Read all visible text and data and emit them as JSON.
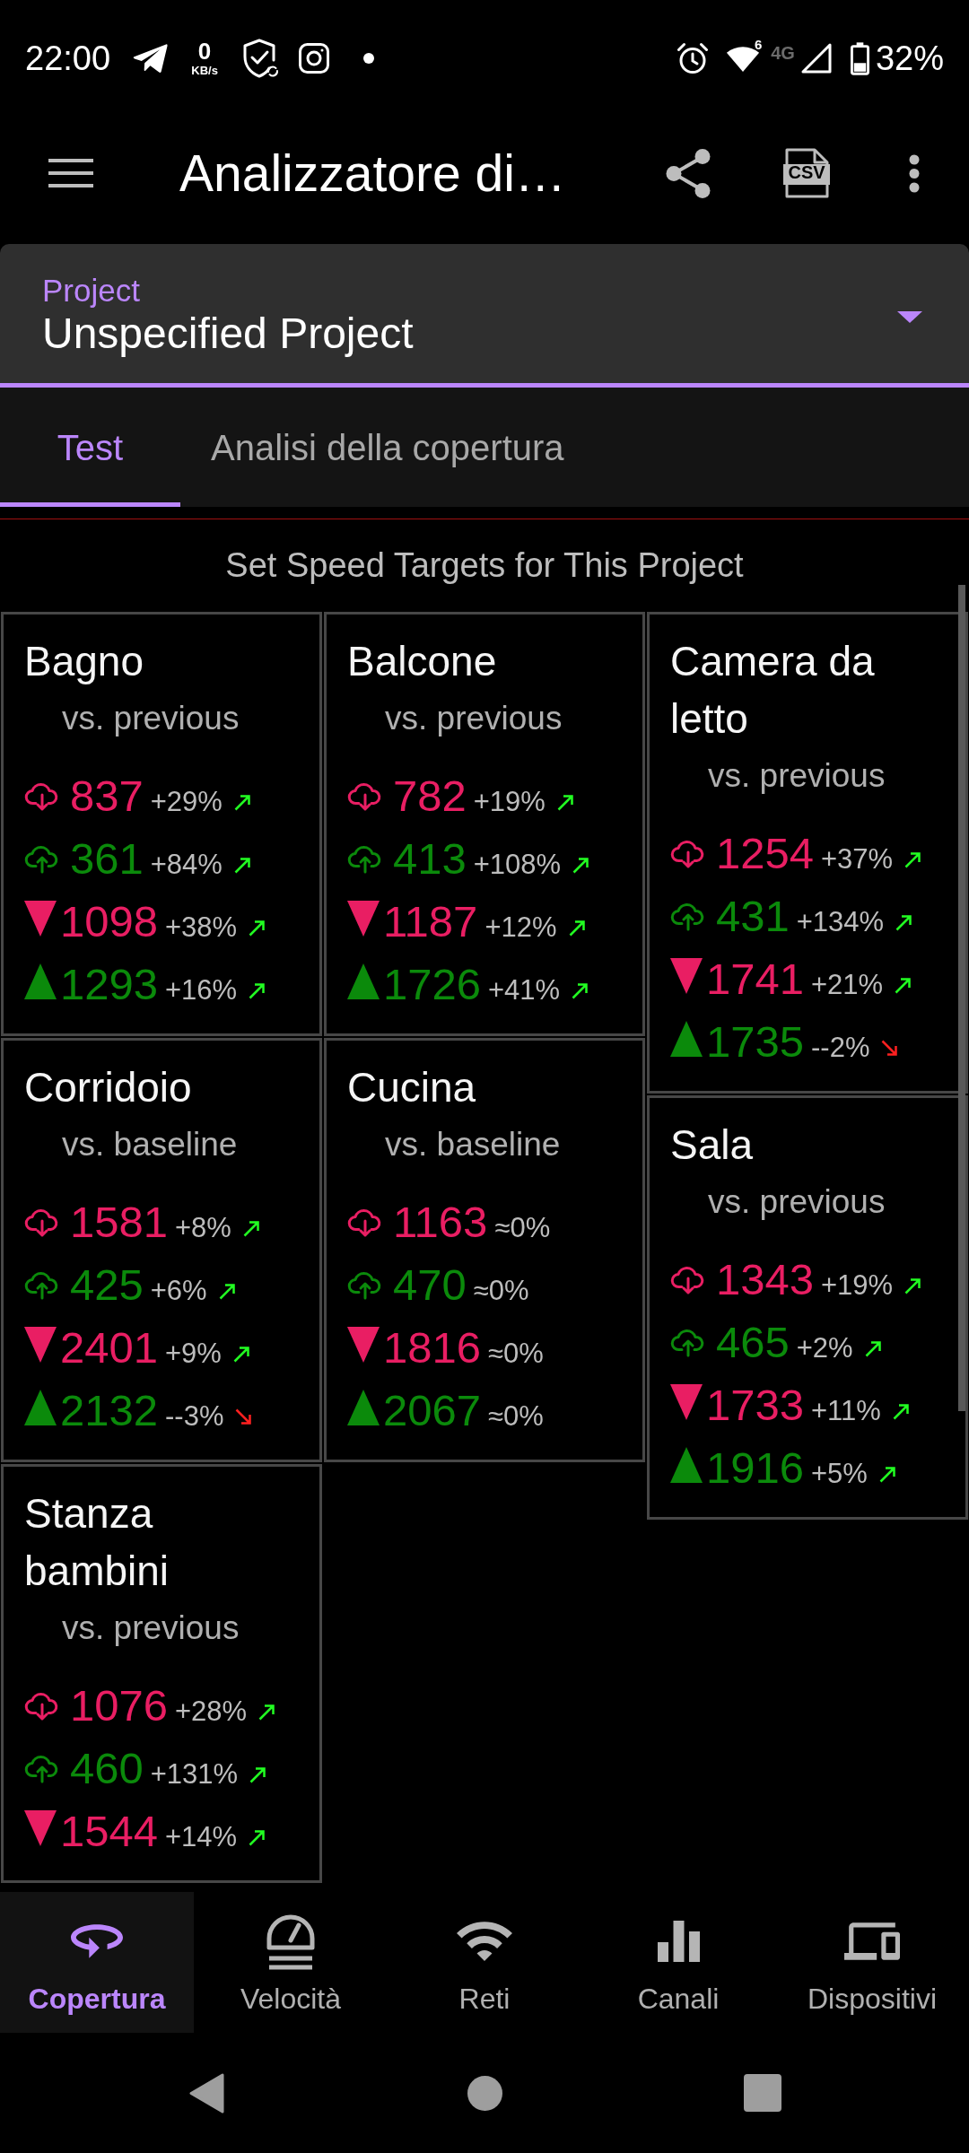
{
  "status_bar": {
    "time": "22:00",
    "net_speed_value": "0",
    "net_speed_unit": "KB/s",
    "wifi_badge": "6",
    "network_type": "4G",
    "battery": "32%"
  },
  "app_bar": {
    "title": "Analizzatore di…",
    "csv_label": "CSV"
  },
  "project": {
    "label": "Project",
    "value": "Unspecified Project"
  },
  "tabs": [
    {
      "label": "Test",
      "selected": true
    },
    {
      "label": "Analisi della copertura",
      "selected": false
    }
  ],
  "targets_link": "Set Speed Targets for This Project",
  "cards": [
    {
      "title": "Bagno",
      "comparison": "vs. previous",
      "metrics": [
        {
          "kind": "cloud-down",
          "value": "837",
          "change": "+29%",
          "trend": {
            "kind": "up"
          }
        },
        {
          "kind": "cloud-up",
          "value": "361",
          "change": "+84%",
          "trend": {
            "kind": "up"
          }
        },
        {
          "kind": "triangle-down",
          "value": "1098",
          "change": "+38%",
          "trend": {
            "kind": "up"
          }
        },
        {
          "kind": "triangle-up",
          "value": "1293",
          "change": "+16%",
          "trend": {
            "kind": "up"
          }
        }
      ]
    },
    {
      "title": "Balcone",
      "comparison": "vs. previous",
      "metrics": [
        {
          "kind": "cloud-down",
          "value": "782",
          "change": "+19%",
          "trend": {
            "kind": "up"
          }
        },
        {
          "kind": "cloud-up",
          "value": "413",
          "change": "+108%",
          "trend": {
            "kind": "up"
          }
        },
        {
          "kind": "triangle-down",
          "value": "1187",
          "change": "+12%",
          "trend": {
            "kind": "up"
          }
        },
        {
          "kind": "triangle-up",
          "value": "1726",
          "change": "+41%",
          "trend": {
            "kind": "up"
          }
        }
      ]
    },
    {
      "title": "Camera da letto",
      "comparison": "vs. previous",
      "metrics": [
        {
          "kind": "cloud-down",
          "value": "1254",
          "change": "+37%",
          "trend": {
            "kind": "up"
          }
        },
        {
          "kind": "cloud-up",
          "value": "431",
          "change": "+134%",
          "trend": {
            "kind": "up"
          }
        },
        {
          "kind": "triangle-down",
          "value": "1741",
          "change": "+21%",
          "trend": {
            "kind": "up"
          }
        },
        {
          "kind": "triangle-up",
          "value": "1735",
          "change": "--2%",
          "trend": {
            "kind": "down"
          }
        }
      ]
    },
    {
      "title": "Corridoio",
      "comparison": "vs. baseline",
      "metrics": [
        {
          "kind": "cloud-down",
          "value": "1581",
          "change": "+8%",
          "trend": {
            "kind": "up"
          }
        },
        {
          "kind": "cloud-up",
          "value": "425",
          "change": "+6%",
          "trend": {
            "kind": "up"
          }
        },
        {
          "kind": "triangle-down",
          "value": "2401",
          "change": "+9%",
          "trend": {
            "kind": "up"
          }
        },
        {
          "kind": "triangle-up",
          "value": "2132",
          "change": "--3%",
          "trend": {
            "kind": "down"
          }
        }
      ]
    },
    {
      "title": "Cucina",
      "comparison": "vs. baseline",
      "metrics": [
        {
          "kind": "cloud-down",
          "value": "1163",
          "change": "≈0%"
        },
        {
          "kind": "cloud-up",
          "value": "470",
          "change": "≈0%"
        },
        {
          "kind": "triangle-down",
          "value": "1816",
          "change": "≈0%"
        },
        {
          "kind": "triangle-up",
          "value": "2067",
          "change": "≈0%"
        }
      ]
    },
    {
      "title": "Sala",
      "comparison": "vs. previous",
      "metrics": [
        {
          "kind": "cloud-down",
          "value": "1343",
          "change": "+19%",
          "trend": {
            "kind": "up"
          }
        },
        {
          "kind": "cloud-up",
          "value": "465",
          "change": "+2%",
          "trend": {
            "kind": "up"
          }
        },
        {
          "kind": "triangle-down",
          "value": "1733",
          "change": "+11%",
          "trend": {
            "kind": "up"
          }
        },
        {
          "kind": "triangle-up",
          "value": "1916",
          "change": "+5%",
          "trend": {
            "kind": "up"
          }
        }
      ]
    },
    {
      "title": "Stanza bambini",
      "comparison": "vs. previous",
      "metrics": [
        {
          "kind": "cloud-down",
          "value": "1076",
          "change": "+28%",
          "trend": {
            "kind": "up"
          }
        },
        {
          "kind": "cloud-up",
          "value": "460",
          "change": "+131%",
          "trend": {
            "kind": "up"
          }
        },
        {
          "kind": "triangle-down",
          "value": "1544",
          "change": "+14%",
          "trend": {
            "kind": "up"
          }
        }
      ]
    }
  ],
  "bottom_nav": [
    {
      "label": "Copertura",
      "kind": "loop",
      "selected": true
    },
    {
      "label": "Velocità",
      "kind": "speedometer",
      "selected": false
    },
    {
      "label": "Reti",
      "kind": "wifi",
      "selected": false
    },
    {
      "label": "Canali",
      "kind": "bars",
      "selected": false
    },
    {
      "label": "Dispositivi",
      "kind": "devices",
      "selected": false
    }
  ]
}
